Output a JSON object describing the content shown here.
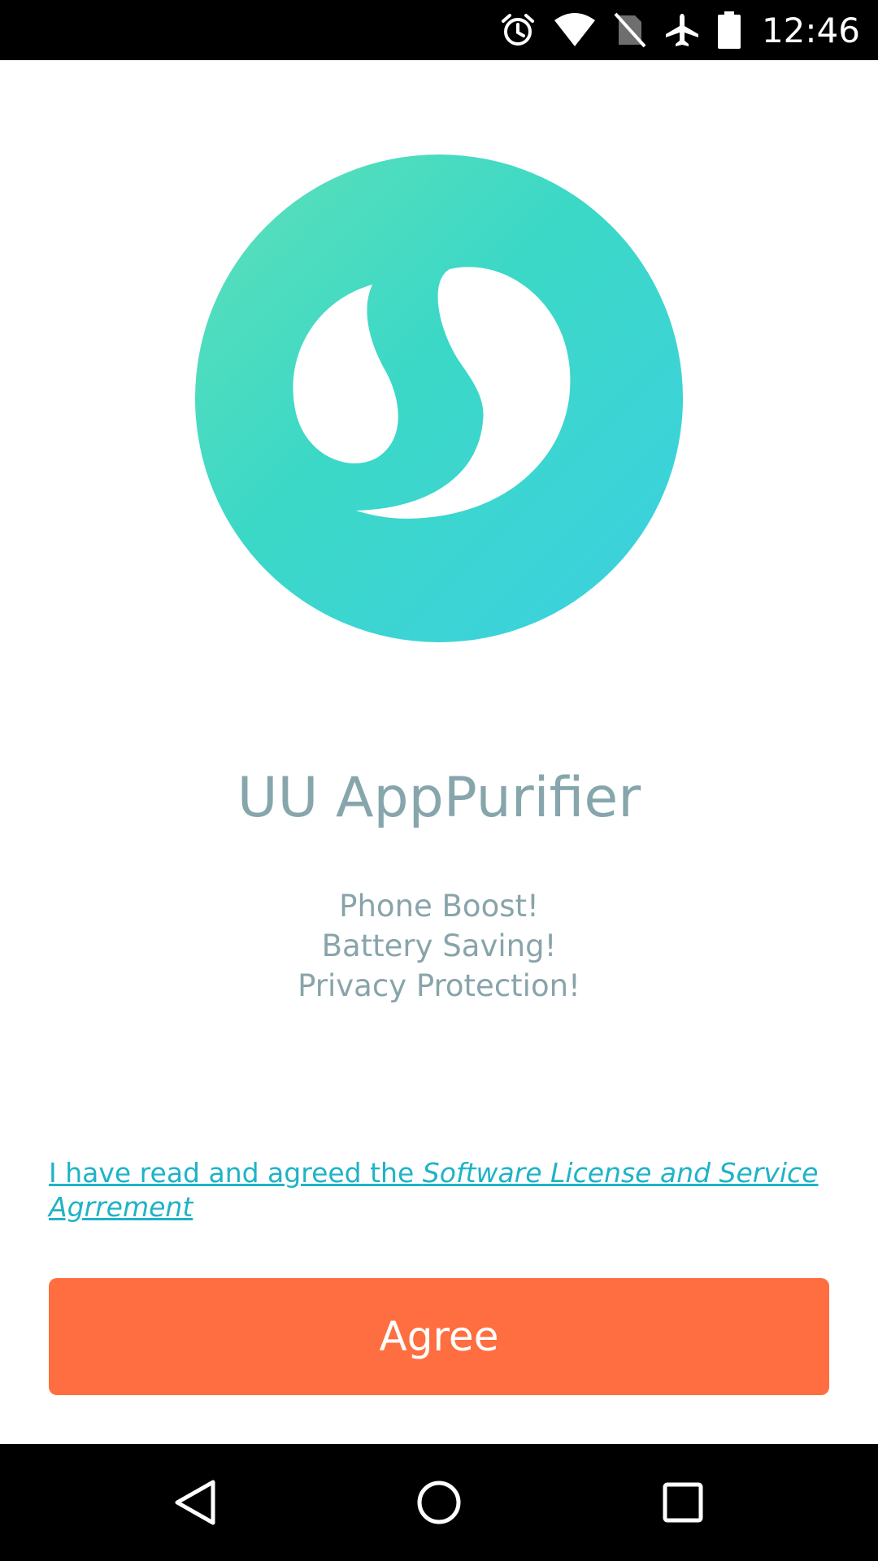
{
  "status_bar": {
    "time": "12:46",
    "icons": [
      "alarm-icon",
      "wifi-icon",
      "no-sim-icon",
      "airplane-mode-icon",
      "battery-icon"
    ]
  },
  "app": {
    "title": "UU AppPurifier",
    "features": [
      "Phone Boost!",
      "Battery Saving!",
      "Privacy Protection!"
    ],
    "logo_icon": "uu-apppurifier-logo",
    "colors": {
      "logo_gradient_start": "#5ee0b8",
      "logo_gradient_end": "#3dd0e2",
      "title": "#86a6ac",
      "link": "#1fb3c6",
      "button": "#ff6e40"
    }
  },
  "agreement": {
    "prefix": "I have read and agreed the ",
    "link_text": "Software License and Service Agrrement"
  },
  "button": {
    "agree_label": "Agree"
  },
  "nav_bar": {
    "icons": [
      "back-icon",
      "home-icon",
      "recents-icon"
    ]
  }
}
